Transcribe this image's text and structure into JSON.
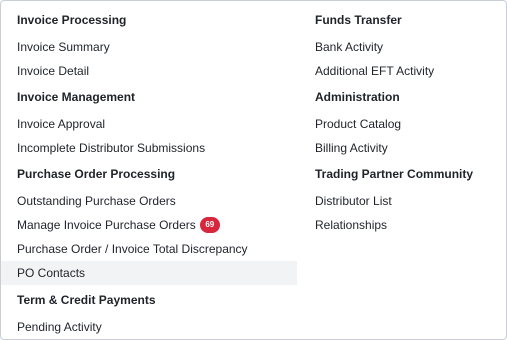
{
  "left": {
    "sections": [
      {
        "heading": "Invoice Processing",
        "items": [
          {
            "label": "Invoice Summary"
          },
          {
            "label": "Invoice Detail"
          }
        ]
      },
      {
        "heading": "Invoice Management",
        "items": [
          {
            "label": "Invoice Approval"
          },
          {
            "label": "Incomplete Distributor Submissions"
          }
        ]
      },
      {
        "heading": "Purchase Order Processing",
        "items": [
          {
            "label": "Outstanding Purchase Orders"
          },
          {
            "label": "Manage Invoice Purchase Orders",
            "badge": "69"
          },
          {
            "label": "Purchase Order / Invoice Total Discrepancy"
          },
          {
            "label": "PO Contacts",
            "hovered": true
          }
        ]
      },
      {
        "heading": "Term & Credit Payments",
        "items": [
          {
            "label": "Pending Activity"
          }
        ]
      }
    ]
  },
  "right": {
    "sections": [
      {
        "heading": "Funds Transfer",
        "items": [
          {
            "label": "Bank Activity"
          },
          {
            "label": "Additional EFT Activity"
          }
        ]
      },
      {
        "heading": "Administration",
        "items": [
          {
            "label": "Product Catalog"
          },
          {
            "label": "Billing Activity"
          }
        ]
      },
      {
        "heading": "Trading Partner Community",
        "items": [
          {
            "label": "Distributor List"
          },
          {
            "label": "Relationships"
          }
        ]
      }
    ]
  },
  "colors": {
    "badge": "#d8263d",
    "hover_row": "#f2f3f5",
    "text": "#1f2329",
    "border": "#c9ced6"
  }
}
